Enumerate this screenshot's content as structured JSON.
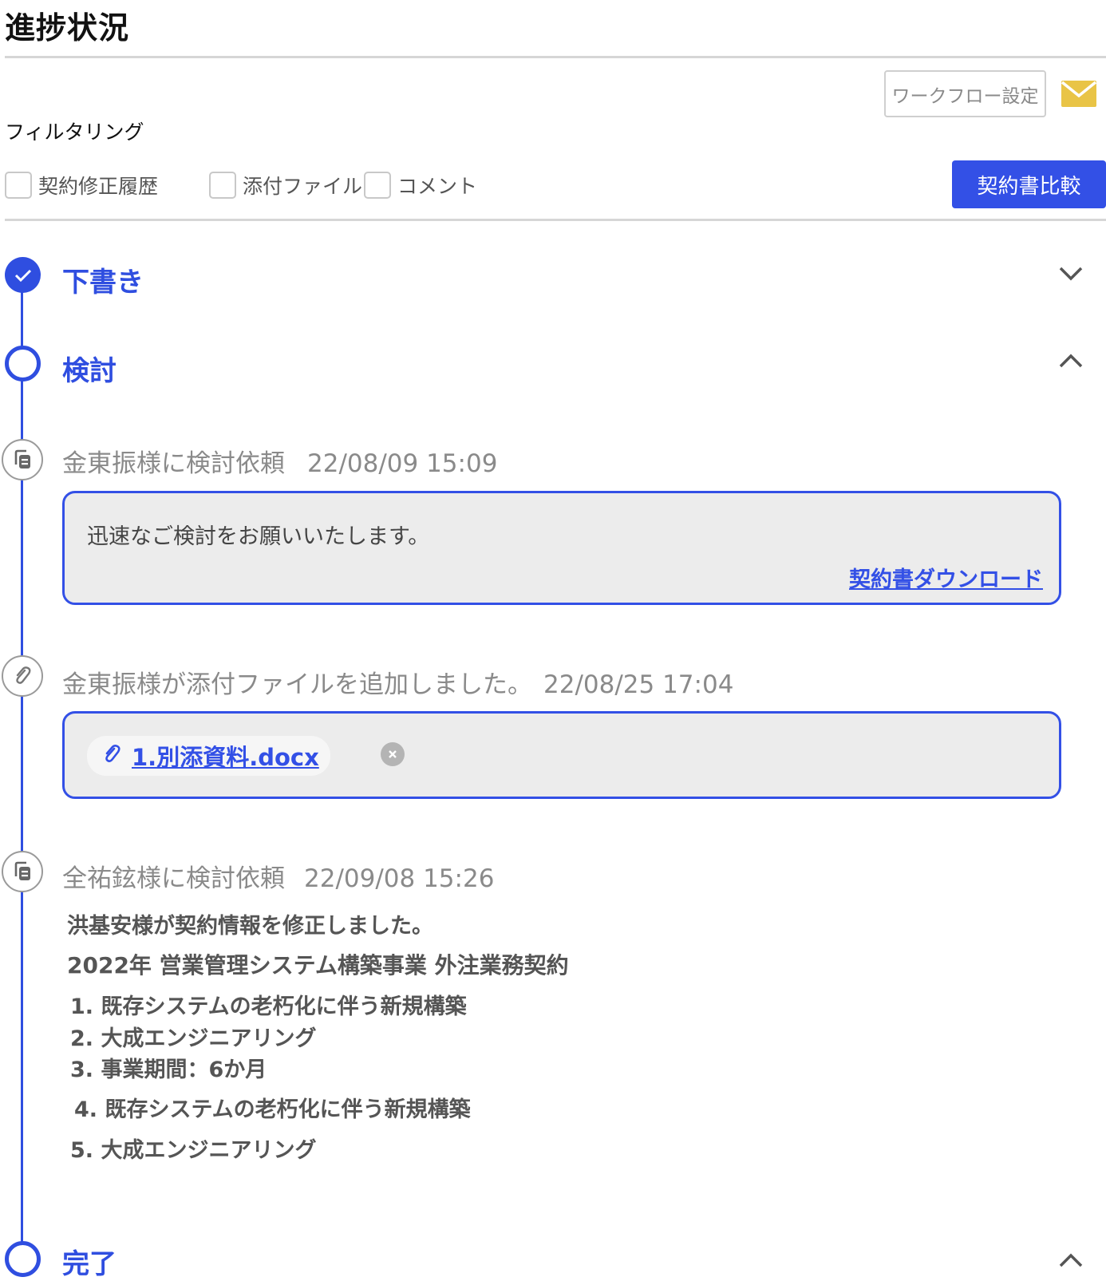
{
  "page": {
    "title": "進捗状況"
  },
  "toolbar": {
    "workflow_settings_label": "ワークフロー設定",
    "mail_icon": "mail-icon",
    "compare_button_label": "契約書比較"
  },
  "filter": {
    "label": "フィルタリング",
    "options": [
      "契約修正履歴",
      "添付ファイル",
      "コメント"
    ]
  },
  "steps": [
    {
      "label": "下書き",
      "status": "done",
      "chevron": "down"
    },
    {
      "label": "検討",
      "status": "current",
      "chevron": "up"
    },
    {
      "label": "完了",
      "status": "pending",
      "chevron": "up"
    }
  ],
  "events": [
    {
      "icon": "document-copy-icon",
      "text": "金東振様に検討依頼",
      "timestamp": "22/08/09 15:09",
      "message": "迅速なご検討をお願いいたします。",
      "link": "契約書ダウンロード"
    },
    {
      "icon": "paperclip-icon",
      "text": "金東振様が添付ファイルを追加しました。",
      "timestamp": "22/08/25 17:04",
      "file_name": "1.別添資料.docx"
    },
    {
      "icon": "document-copy-icon",
      "text": "全祐鉉様に検討依頼",
      "timestamp": "22/09/08 15:26"
    }
  ],
  "change_log": {
    "heading": "洪基安様が契約情報を修正しました。",
    "contract_title": "2022年 営業管理システム構築事業 外注業務契約",
    "items": [
      "1. 既存システムの老朽化に伴う新規構築",
      "2. 大成エンジニアリング",
      "3. 事業期間：6か月",
      "4. 既存システムの老朽化に伴う新規構築",
      "5. 大成エンジニアリング"
    ]
  },
  "colors": {
    "accent": "#3350e6",
    "muted": "#8a8a8a",
    "card_bg": "#ececec",
    "mail": "#e9c446"
  }
}
